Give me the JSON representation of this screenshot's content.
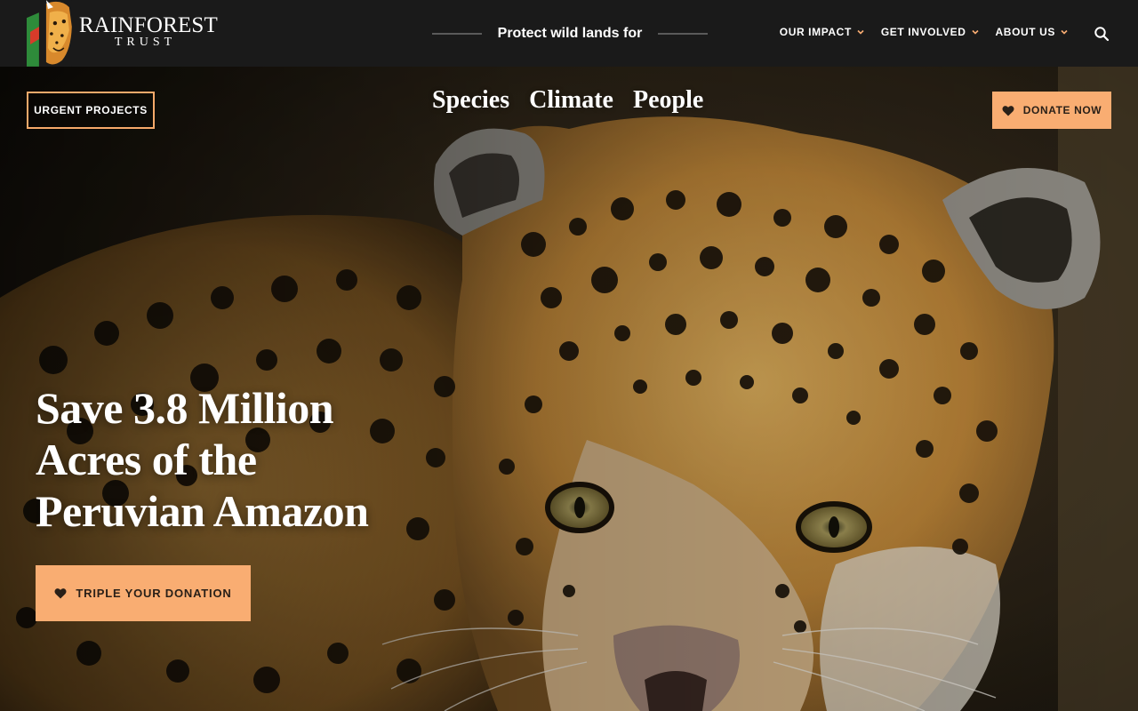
{
  "header": {
    "logo": {
      "name": "RAINFOREST",
      "sub": "TRUST"
    },
    "tagline": "Protect wild lands for",
    "nav": [
      {
        "label": "OUR IMPACT"
      },
      {
        "label": "GET INVOLVED"
      },
      {
        "label": "ABOUT US"
      }
    ],
    "search_icon": "search-icon"
  },
  "hero": {
    "urgent_label": "URGENT PROJECTS",
    "donate_label": "DONATE NOW",
    "topics": [
      "Species",
      "Climate",
      "People"
    ],
    "headline": [
      "Save 3.8 Million",
      "Acres of the",
      "Peruvian Amazon"
    ],
    "cta_label": "TRIPLE YOUR DONATION",
    "photo": "jaguar-photo"
  },
  "colors": {
    "accent": "#f9ad72",
    "topbar": "#1a1a1a",
    "text": "#ffffff"
  }
}
